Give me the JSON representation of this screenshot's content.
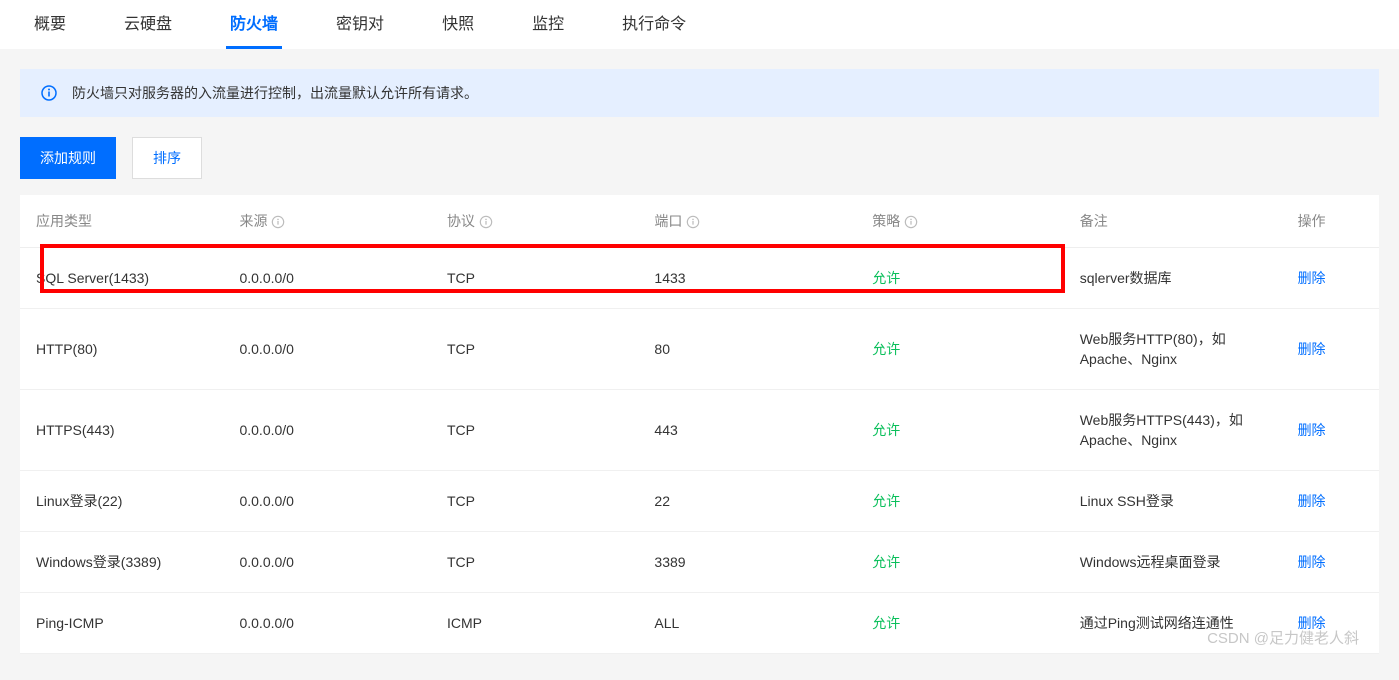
{
  "tabs": [
    {
      "label": "概要",
      "active": false
    },
    {
      "label": "云硬盘",
      "active": false
    },
    {
      "label": "防火墙",
      "active": true
    },
    {
      "label": "密钥对",
      "active": false
    },
    {
      "label": "快照",
      "active": false
    },
    {
      "label": "监控",
      "active": false
    },
    {
      "label": "执行命令",
      "active": false
    }
  ],
  "banner": {
    "text": "防火墙只对服务器的入流量进行控制，出流量默认允许所有请求。"
  },
  "toolbar": {
    "add_label": "添加规则",
    "sort_label": "排序"
  },
  "table": {
    "headers": {
      "type": "应用类型",
      "source": "来源",
      "protocol": "协议",
      "port": "端口",
      "policy": "策略",
      "remark": "备注",
      "action": "操作"
    },
    "rows": [
      {
        "type": "SQL Server(1433)",
        "source": "0.0.0.0/0",
        "protocol": "TCP",
        "port": "1433",
        "policy": "允许",
        "remark": "sqlerver数据库",
        "action": "删除",
        "highlighted": true
      },
      {
        "type": "HTTP(80)",
        "source": "0.0.0.0/0",
        "protocol": "TCP",
        "port": "80",
        "policy": "允许",
        "remark": "Web服务HTTP(80)，如Apache、Nginx",
        "action": "删除"
      },
      {
        "type": "HTTPS(443)",
        "source": "0.0.0.0/0",
        "protocol": "TCP",
        "port": "443",
        "policy": "允许",
        "remark": "Web服务HTTPS(443)，如Apache、Nginx",
        "action": "删除"
      },
      {
        "type": "Linux登录(22)",
        "source": "0.0.0.0/0",
        "protocol": "TCP",
        "port": "22",
        "policy": "允许",
        "remark": "Linux SSH登录",
        "action": "删除"
      },
      {
        "type": "Windows登录(3389)",
        "source": "0.0.0.0/0",
        "protocol": "TCP",
        "port": "3389",
        "policy": "允许",
        "remark": "Windows远程桌面登录",
        "action": "删除"
      },
      {
        "type": "Ping-ICMP",
        "source": "0.0.0.0/0",
        "protocol": "ICMP",
        "port": "ALL",
        "policy": "允许",
        "remark": "通过Ping测试网络连通性",
        "action": "删除"
      }
    ]
  },
  "watermark": "CSDN @足力健老人斜"
}
